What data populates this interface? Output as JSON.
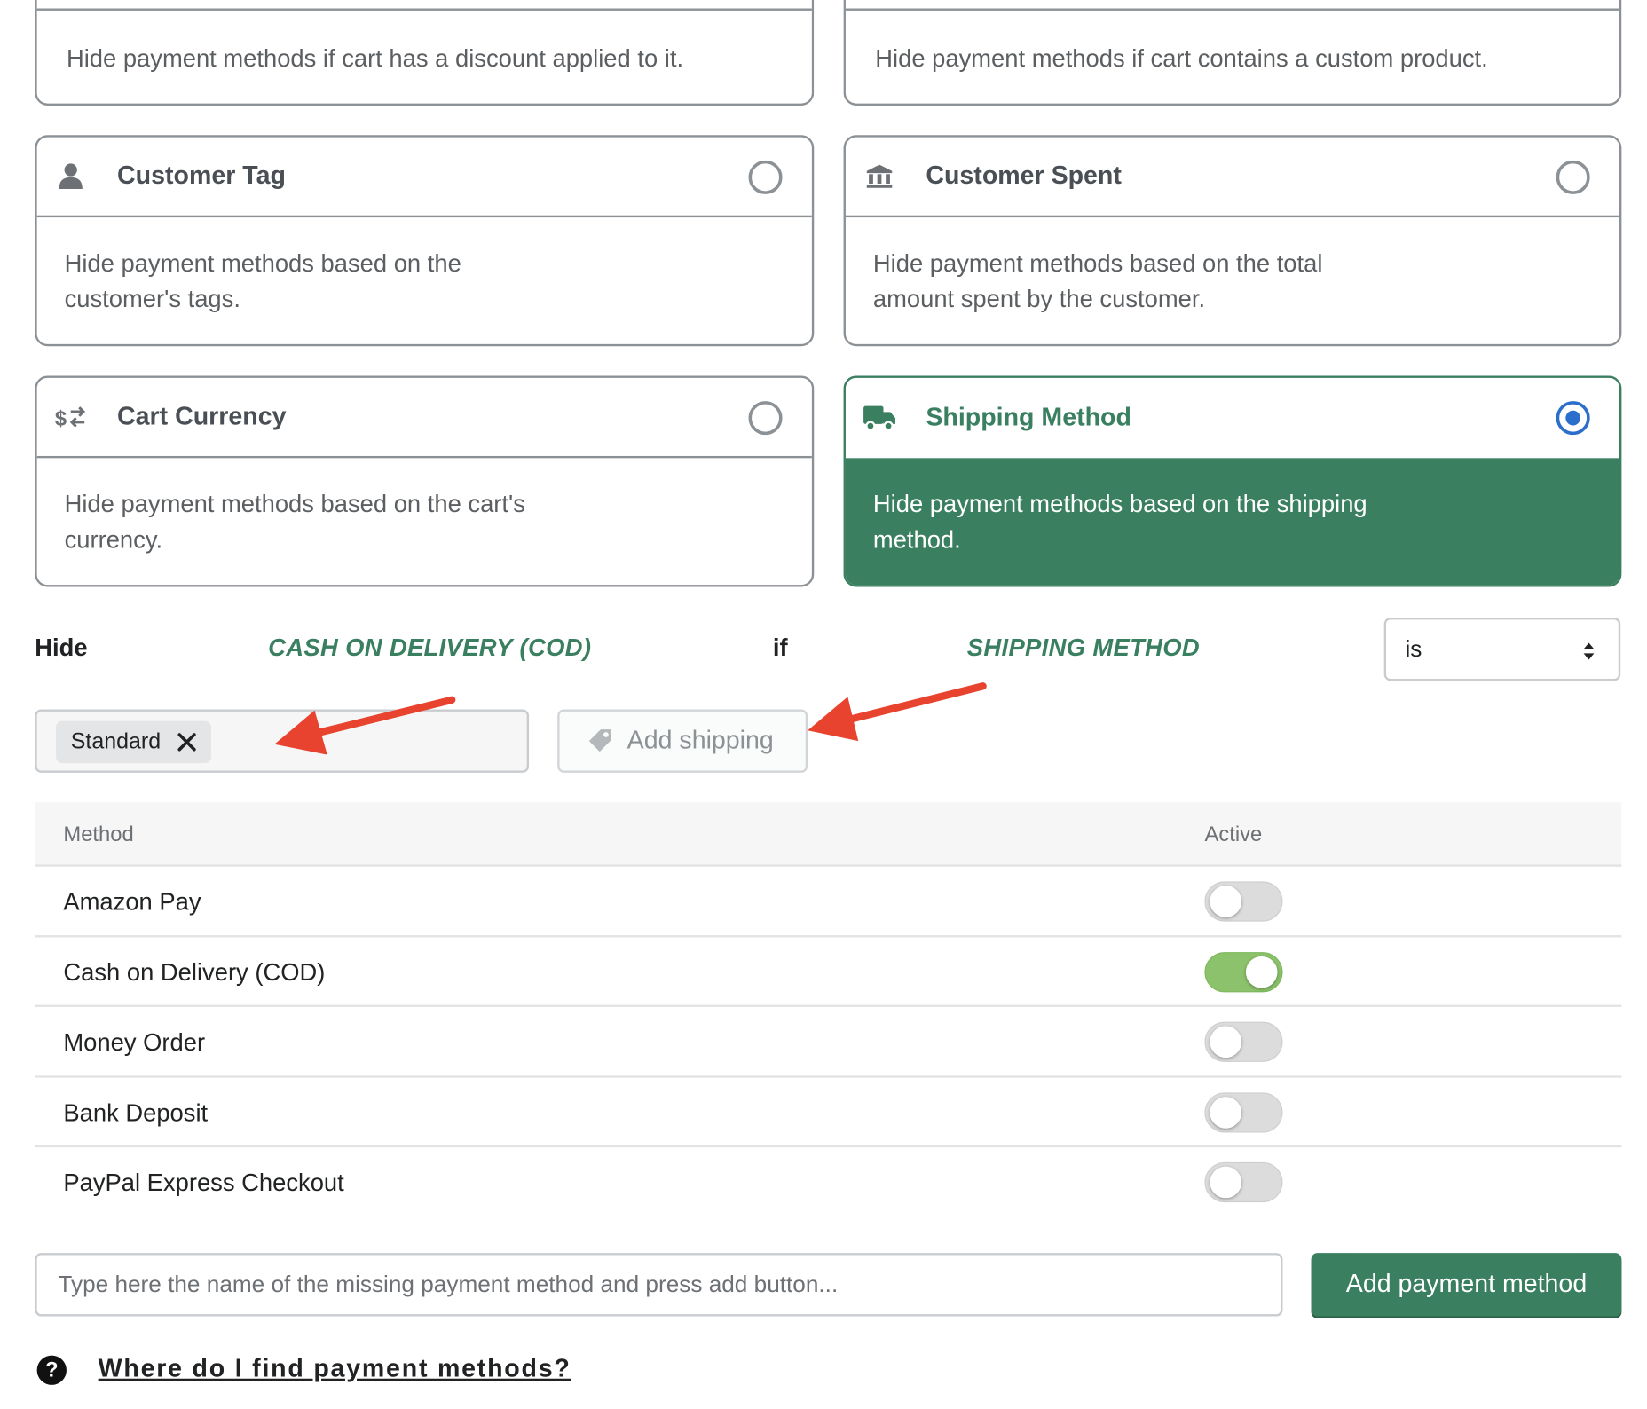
{
  "top_cards": {
    "left_text": "Hide payment methods if cart has a discount applied to it.",
    "right_text": "Hide payment methods if cart contains a custom product."
  },
  "cards": [
    {
      "title": "Customer Tag",
      "description": "Hide payment methods based on the customer's tags.",
      "icon": "person-icon",
      "selected": false
    },
    {
      "title": "Customer Spent",
      "description": "Hide payment methods based on the total amount spent by the customer.",
      "icon": "bank-icon",
      "selected": false
    },
    {
      "title": "Cart Currency",
      "description": "Hide payment methods based on the cart's currency.",
      "icon": "currency-exchange-icon",
      "selected": false
    },
    {
      "title": "Shipping Method",
      "description": "Hide payment methods based on the shipping method.",
      "icon": "truck-icon",
      "selected": true
    }
  ],
  "condition": {
    "hide_label": "Hide",
    "payment_method": "CASH ON DELIVERY (COD)",
    "if_label": "if",
    "condition_type": "SHIPPING METHOD",
    "operator": "is"
  },
  "shipping_tags": [
    "Standard"
  ],
  "add_shipping_label": "Add shipping",
  "table": {
    "headers": {
      "method": "Method",
      "active": "Active"
    },
    "rows": [
      {
        "name": "Amazon Pay",
        "active": false
      },
      {
        "name": "Cash on Delivery (COD)",
        "active": true
      },
      {
        "name": "Money Order",
        "active": false
      },
      {
        "name": "Bank Deposit",
        "active": false
      },
      {
        "name": "PayPal Express Checkout",
        "active": false
      }
    ]
  },
  "new_method": {
    "placeholder": "Type here the name of the missing payment method and press add button...",
    "button_label": "Add payment method"
  },
  "help": {
    "icon": "question-icon",
    "link_text": "Where do I find payment methods?"
  },
  "colors": {
    "brand_green": "#3a7f60",
    "toggle_on": "#8cc26b",
    "radio_selected": "#2c6ecb",
    "annotation_arrow": "#e8432e"
  }
}
